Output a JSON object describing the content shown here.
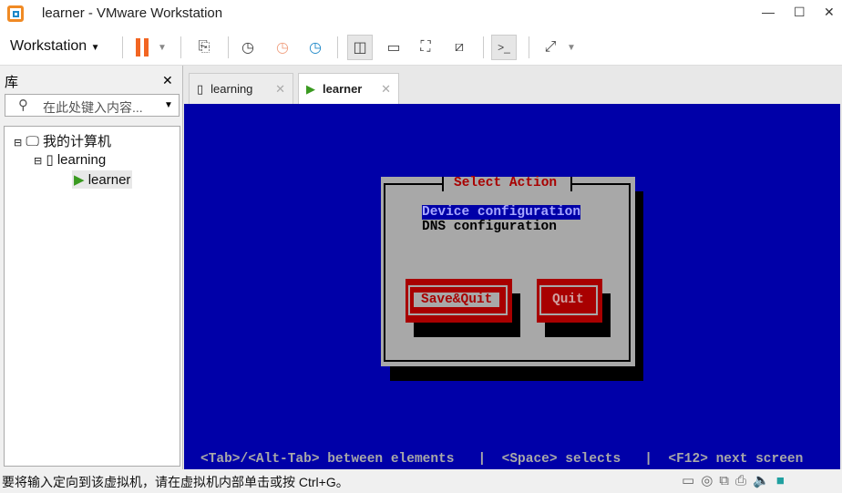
{
  "window": {
    "title": "learner - VMware Workstation",
    "min": "—",
    "max": "☐",
    "close": "✕"
  },
  "toolbar": {
    "menu": "Workstation"
  },
  "library": {
    "title": "库",
    "close": "✕",
    "search_placeholder": "在此处键入内容...",
    "tree": [
      {
        "label": "我的计算机"
      },
      {
        "label": "learning"
      },
      {
        "label": "learner"
      }
    ]
  },
  "tabs": [
    {
      "label": "learning",
      "active": false
    },
    {
      "label": "learner",
      "active": true
    }
  ],
  "console": {
    "dialog_title": "Select Action",
    "items": [
      "Device configuration",
      "DNS configuration"
    ],
    "selected": 0,
    "buttons": [
      "Save&Quit",
      "Quit"
    ],
    "help": "<Tab>/<Alt-Tab> between elements   |  <Space> selects   |  <F12> next screen",
    "colors": {
      "bg": "#0000a8",
      "dialog": "#a8a8a8",
      "button": "#a80000"
    }
  },
  "status": {
    "message": "要将输入定向到该虚拟机，请在虚拟机内部单击或按 Ctrl+G。"
  }
}
